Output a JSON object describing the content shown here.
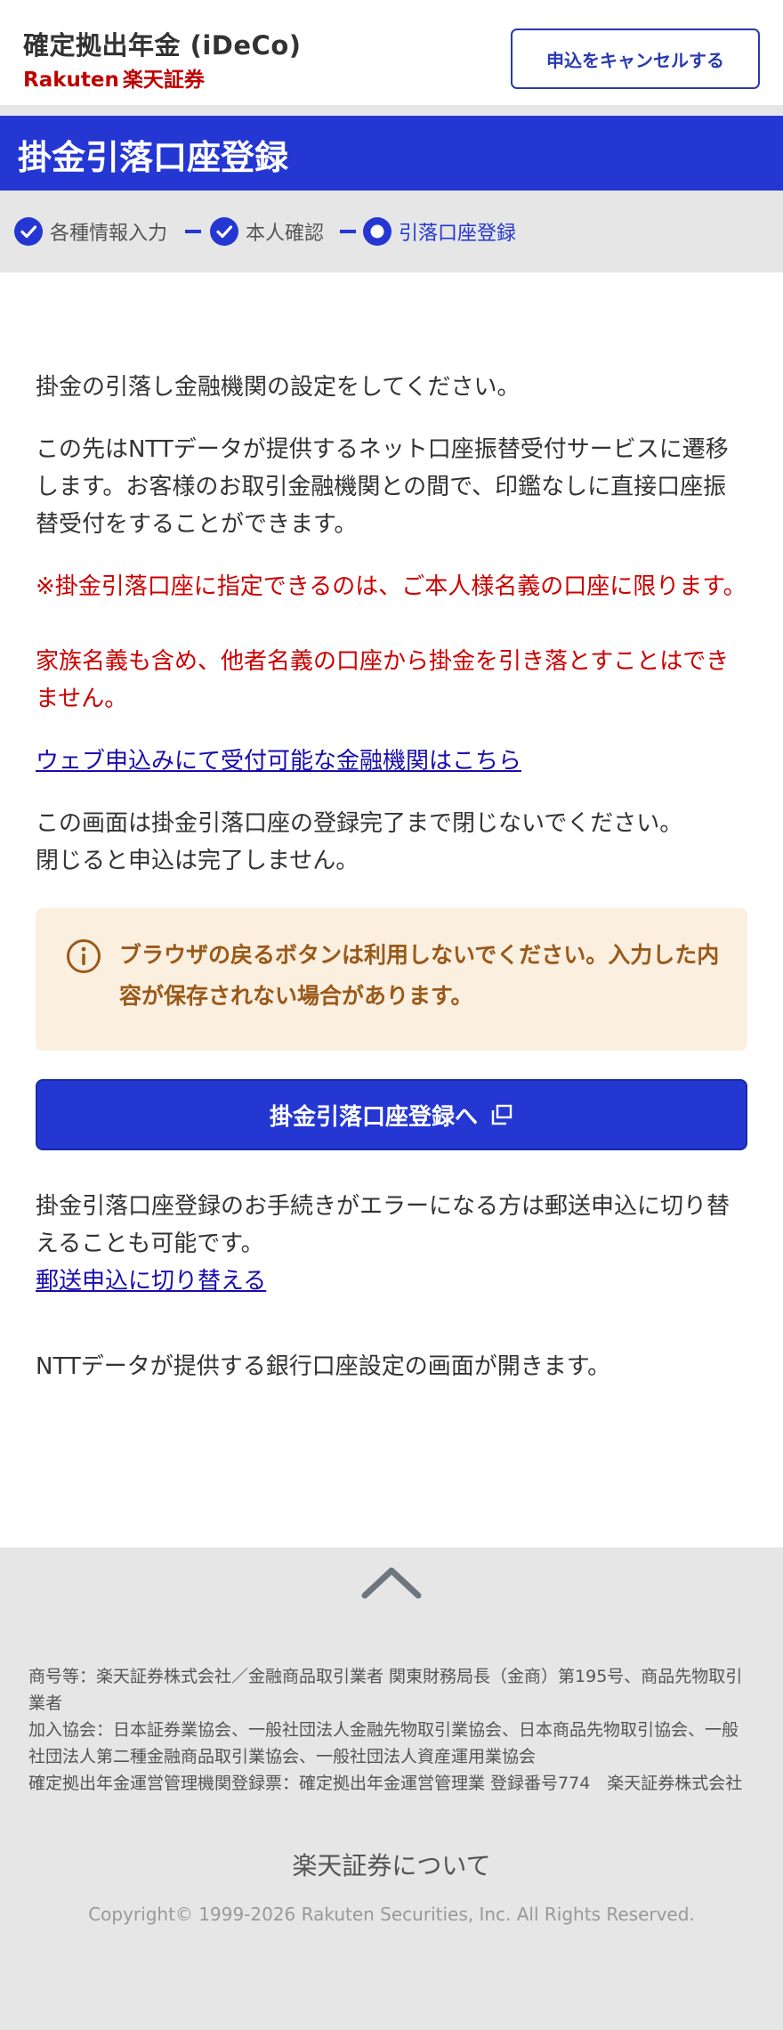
{
  "header": {
    "brand_title": "確定拠出年金 (iDeCo)",
    "brand_company_latin": "Rakuten",
    "brand_company_jp": "楽天証券",
    "cancel_label": "申込をキャンセルする"
  },
  "page": {
    "title": "掛金引落口座登録"
  },
  "steps": [
    {
      "label": "各種情報入力",
      "state": "done"
    },
    {
      "label": "本人確認",
      "state": "done"
    },
    {
      "label": "引落口座登録",
      "state": "current"
    }
  ],
  "main": {
    "intro": "掛金の引落し金融機関の設定をしてください。",
    "description": "この先はNTTデータが提供するネット口座振替受付サービスに遷移します。お客様のお取引金融機関との間で、印鑑なしに直接口座振替受付をすることができます。",
    "warning_line1": "※掛金引落口座に指定できるのは、ご本人様名義の口座に限ります。",
    "warning_line2": "家族名義も含め、他者名義の口座から掛金を引き落とすことはできません。",
    "institutions_link": "ウェブ申込みにて受付可能な金融機関はこちら",
    "keep_open_line1": "この画面は掛金引落口座の登録完了まで閉じないでください。",
    "keep_open_line2": "閉じると申込は完了しません。",
    "notice": "ブラウザの戻るボタンは利用しないでください。入力した内容が保存されない場合があります。",
    "primary_button": "掛金引落口座登録へ",
    "error_note": "掛金引落口座登録のお手続きがエラーになる方は郵送申込に切り替えることも可能です。",
    "mail_link": "郵送申込に切り替える",
    "ntt_note": "NTTデータが提供する銀行口座設定の画面が開きます。"
  },
  "footer": {
    "legal_line1": "商号等：楽天証券株式会社／金融商品取引業者 関東財務局長（金商）第195号、商品先物取引業者",
    "legal_line2": "加入協会：日本証券業協会、一般社団法人金融先物取引業協会、日本商品先物取引協会、一般社団法人第二種金融商品取引業協会、一般社団法人資産運用業協会",
    "legal_line3": "確定拠出年金運営管理機関登録票：確定拠出年金運営管理業 登録番号774　楽天証券株式会社",
    "about_link": "楽天証券について",
    "copyright": "Copyright© 1999-2026 Rakuten Securities, Inc. All Rights Reserved."
  },
  "colors": {
    "primary_blue": "#2437d3",
    "brand_red": "#bf0000",
    "warning_red": "#cc0000",
    "notice_bg": "#fbefe0",
    "notice_text": "#9a5a1a",
    "link": "#1a0dab"
  },
  "icons": {
    "step_done": "check-circle-icon",
    "step_current": "current-step-ring-icon",
    "notice": "info-circle-icon",
    "external": "external-window-icon",
    "page_top": "chevron-up-icon"
  }
}
